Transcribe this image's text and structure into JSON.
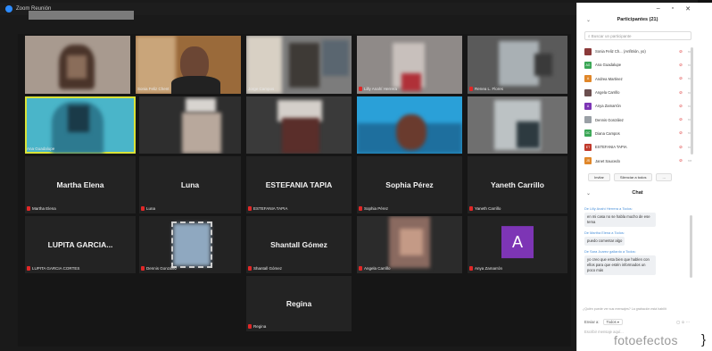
{
  "window": {
    "title": "Zoom Reunión"
  },
  "gallery": {
    "row1": [
      {
        "label": ""
      },
      {
        "label": "Sonia Feliz Chent"
      },
      {
        "label": "Jorge Campos"
      },
      {
        "label": "Lilly Anahí Herrera"
      },
      {
        "label": "Renea L. Flores"
      }
    ],
    "row2": [
      {
        "label": "Ana Guadalupe"
      },
      {
        "label": ""
      },
      {
        "label": ""
      },
      {
        "label": ""
      },
      {
        "label": ""
      }
    ],
    "row3": [
      {
        "name": "Martha Elena",
        "label": "Martha Elena"
      },
      {
        "name": "Luna",
        "label": "Luna"
      },
      {
        "name": "ESTEFANIA TAPIA",
        "label": "ESTEFANIA TAPIA"
      },
      {
        "name": "Sophia Pérez",
        "label": "Sophia Pérez"
      },
      {
        "name": "Yaneth Carrillo",
        "label": "Yaneth Carrillo"
      }
    ],
    "row4": [
      {
        "name": "LUPITA GARCIA...",
        "label": "LUPITA GARCIA CORTES"
      },
      {
        "label": "Dennis González"
      },
      {
        "name": "Shantall Gómez",
        "label": "Shantall Gómez"
      },
      {
        "label": "Angela Carrillo"
      },
      {
        "avatar": "A",
        "label": "Anya Zamarrón"
      }
    ],
    "row5": [
      {
        "name": "Regina",
        "label": "Regina"
      }
    ]
  },
  "colors": {
    "accent": "#2d8cff",
    "active_speaker": "#d8e238",
    "muted": "#e02828",
    "avatar_purple": "#7d35b5"
  },
  "participants": {
    "title": "Participantes (21)",
    "search_placeholder": "Buscar un participante",
    "items": [
      {
        "initials": "",
        "name": "Sonia Feliz Ch... (Anfitrión, yo)",
        "color": "#8b3a3a"
      },
      {
        "initials": "AG",
        "name": "Ana Guadalupe",
        "color": "#3aa655"
      },
      {
        "initials": "A",
        "name": "Andrea Martinez",
        "color": "#e0872a"
      },
      {
        "initials": "",
        "name": "Angela Carrillo",
        "color": "#6b4f4f"
      },
      {
        "initials": "A",
        "name": "Anya Zamarrón",
        "color": "#7d35b5"
      },
      {
        "initials": "",
        "name": "Dennis González",
        "color": "#9aa0a6"
      },
      {
        "initials": "DC",
        "name": "Diana Campos",
        "color": "#3aa655"
      },
      {
        "initials": "ET",
        "name": "ESTEFANIA TAPIA",
        "color": "#c0392b"
      },
      {
        "initials": "JS",
        "name": "Janet Saucedo",
        "color": "#e0872a"
      }
    ],
    "invite_label": "Invitar",
    "mute_all_label": "Silenciar a todos",
    "more_label": "..."
  },
  "chat": {
    "title": "Chat",
    "messages": [
      {
        "from": "De Lilly Anahí Herrera a Todos:",
        "text": "en mi casa no se habla mucho de ese tema"
      },
      {
        "from": "De Martha Elena a Todos:",
        "text": "puedo comentar algo"
      },
      {
        "from": "De Sara Juarez gallardo a Todos:",
        "text": "yo creo que esta bien que hablen con ellos para que estén informados un poco más"
      }
    ],
    "note": "¿Quién puede ver sus mensajes? La grabación está habilit",
    "send_to_label": "Enviar a:",
    "send_to_value": "Todos ▾",
    "send_icons": "▢ ☺ ···",
    "input_placeholder": "Escribir mensaje aquí..."
  },
  "watermark": "fotoefectos",
  "trailing_char": "}"
}
